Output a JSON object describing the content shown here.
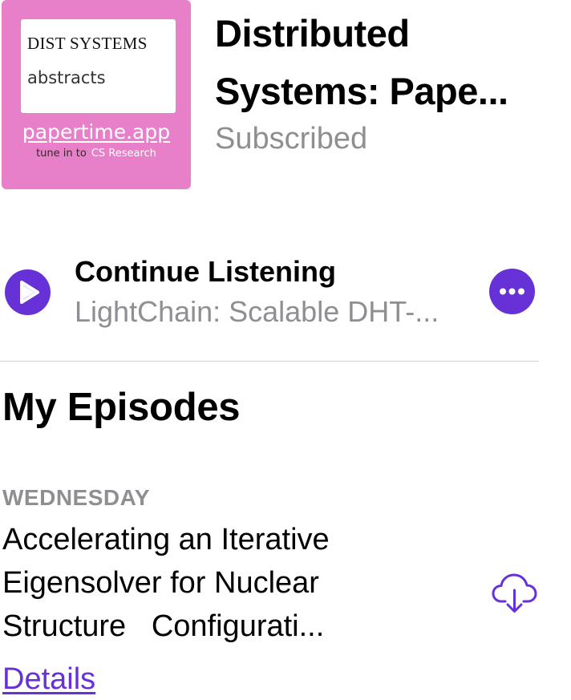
{
  "podcast": {
    "artwork": {
      "card_title": "DIST SYSTEMS",
      "card_subtitle": "abstracts",
      "url": "papertime.app",
      "tagline_prefix": "tune in to",
      "tagline_topic": "CS Research",
      "background_color": "#e77fc9"
    },
    "title_line1": "Distributed",
    "title_line2": "Systems: Pape...",
    "status": "Subscribed"
  },
  "continue_listening": {
    "heading": "Continue Listening",
    "episode": "LightChain: Scalable DHT-...",
    "play_icon": "play-icon",
    "more_icon": "ellipsis-icon"
  },
  "my_episodes": {
    "heading": "My Episodes",
    "episodes": [
      {
        "day": "WEDNESDAY",
        "title_lines": [
          "Accelerating an Iterative",
          "Eigensolver for Nuclear",
          "Structure   Configurati..."
        ],
        "download_icon": "cloud-download-icon",
        "details_label": "Details"
      }
    ]
  },
  "colors": {
    "accent": "#6731d8",
    "secondary_text": "#8e8e93",
    "divider": "#d1d1d6"
  }
}
